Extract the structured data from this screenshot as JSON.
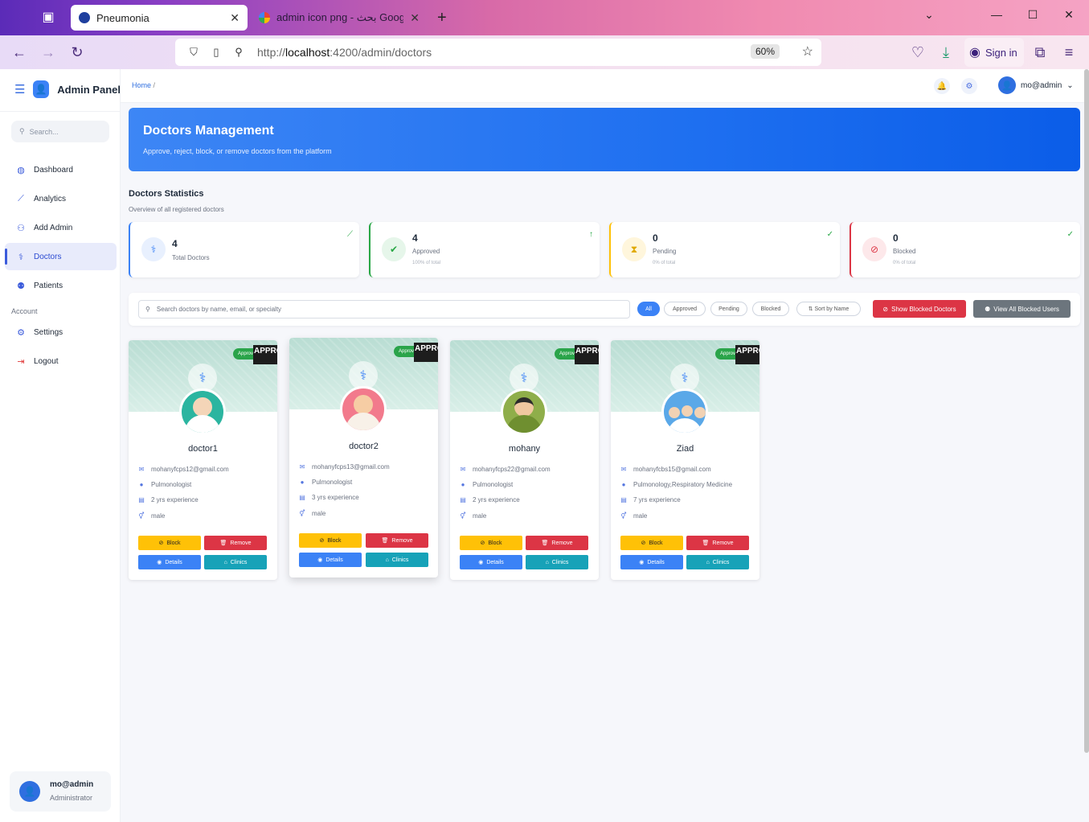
{
  "browser": {
    "tabs": [
      {
        "title": "Pneumonia",
        "active": true
      },
      {
        "title": "admin icon png - بحث Google",
        "active": false
      }
    ],
    "url_prefix": "http://",
    "url_host": "localhost",
    "url_path": ":4200/admin/doctors",
    "zoom": "60%",
    "sign_in": "Sign in"
  },
  "sidebar": {
    "brand": "Admin Panel",
    "search_placeholder": "Search...",
    "items": [
      {
        "label": "Dashboard",
        "icon": "gauge-icon"
      },
      {
        "label": "Analytics",
        "icon": "chart-line-icon"
      },
      {
        "label": "Add Admin",
        "icon": "user-plus-icon"
      },
      {
        "label": "Doctors",
        "icon": "user-doctor-icon"
      },
      {
        "label": "Patients",
        "icon": "users-icon"
      }
    ],
    "section_label": "Account",
    "account_items": [
      {
        "label": "Settings",
        "icon": "gear-icon"
      },
      {
        "label": "Logout",
        "icon": "logout-icon"
      }
    ],
    "user": {
      "name": "mo@admin",
      "role": "Administrator"
    }
  },
  "topbar": {
    "breadcrumb": "Home",
    "breadcrumb_sep": "/",
    "user": "mo@admin"
  },
  "hero": {
    "title": "Doctors Management",
    "subtitle": "Approve, reject, block, or remove doctors from the platform"
  },
  "stats": {
    "title": "Doctors Statistics",
    "subtitle": "Overview of all registered doctors",
    "cards": [
      {
        "value": "4",
        "label": "Total Doctors",
        "pct": "",
        "color": "#3b82f6"
      },
      {
        "value": "4",
        "label": "Approved",
        "pct": "100% of total",
        "color": "#28a745"
      },
      {
        "value": "0",
        "label": "Pending",
        "pct": "0% of total",
        "color": "#ffc107"
      },
      {
        "value": "0",
        "label": "Blocked",
        "pct": "0% of total",
        "color": "#dc3545"
      }
    ]
  },
  "filters": {
    "search_placeholder": "Search doctors by name, email, or specialty",
    "chips": [
      "All",
      "Approved",
      "Pending",
      "Blocked",
      "Sort by Name"
    ],
    "show_blocked": "Show Blocked Doctors",
    "view_blocked": "View All Blocked Users"
  },
  "doctors": [
    {
      "name": "doctor1",
      "email": "mohanyfcps12@gmail.com",
      "specialty": "Pulmonologist",
      "experience": "2 yrs experience",
      "gender": "male",
      "status": "Approved",
      "ribbon": "APPROVED"
    },
    {
      "name": "doctor2",
      "email": "mohanyfcps13@gmail.com",
      "specialty": "Pulmonologist",
      "experience": "3 yrs experience",
      "gender": "male",
      "status": "Approved",
      "ribbon": "APPROVED"
    },
    {
      "name": "mohany",
      "email": "mohanyfcps22@gmail.com",
      "specialty": "Pulmonologist",
      "experience": "2 yrs experience",
      "gender": "male",
      "status": "Approved",
      "ribbon": "APPROVED"
    },
    {
      "name": "Ziad",
      "email": "mohanyfcbs15@gmail.com",
      "specialty": "Pulmonology,Respiratory Medicine",
      "experience": "7 yrs experience",
      "gender": "male",
      "status": "Approved",
      "ribbon": "APPROVED"
    }
  ],
  "card_buttons": {
    "block": "Block",
    "remove": "Remove",
    "details": "Details",
    "clinics": "Clinics"
  }
}
